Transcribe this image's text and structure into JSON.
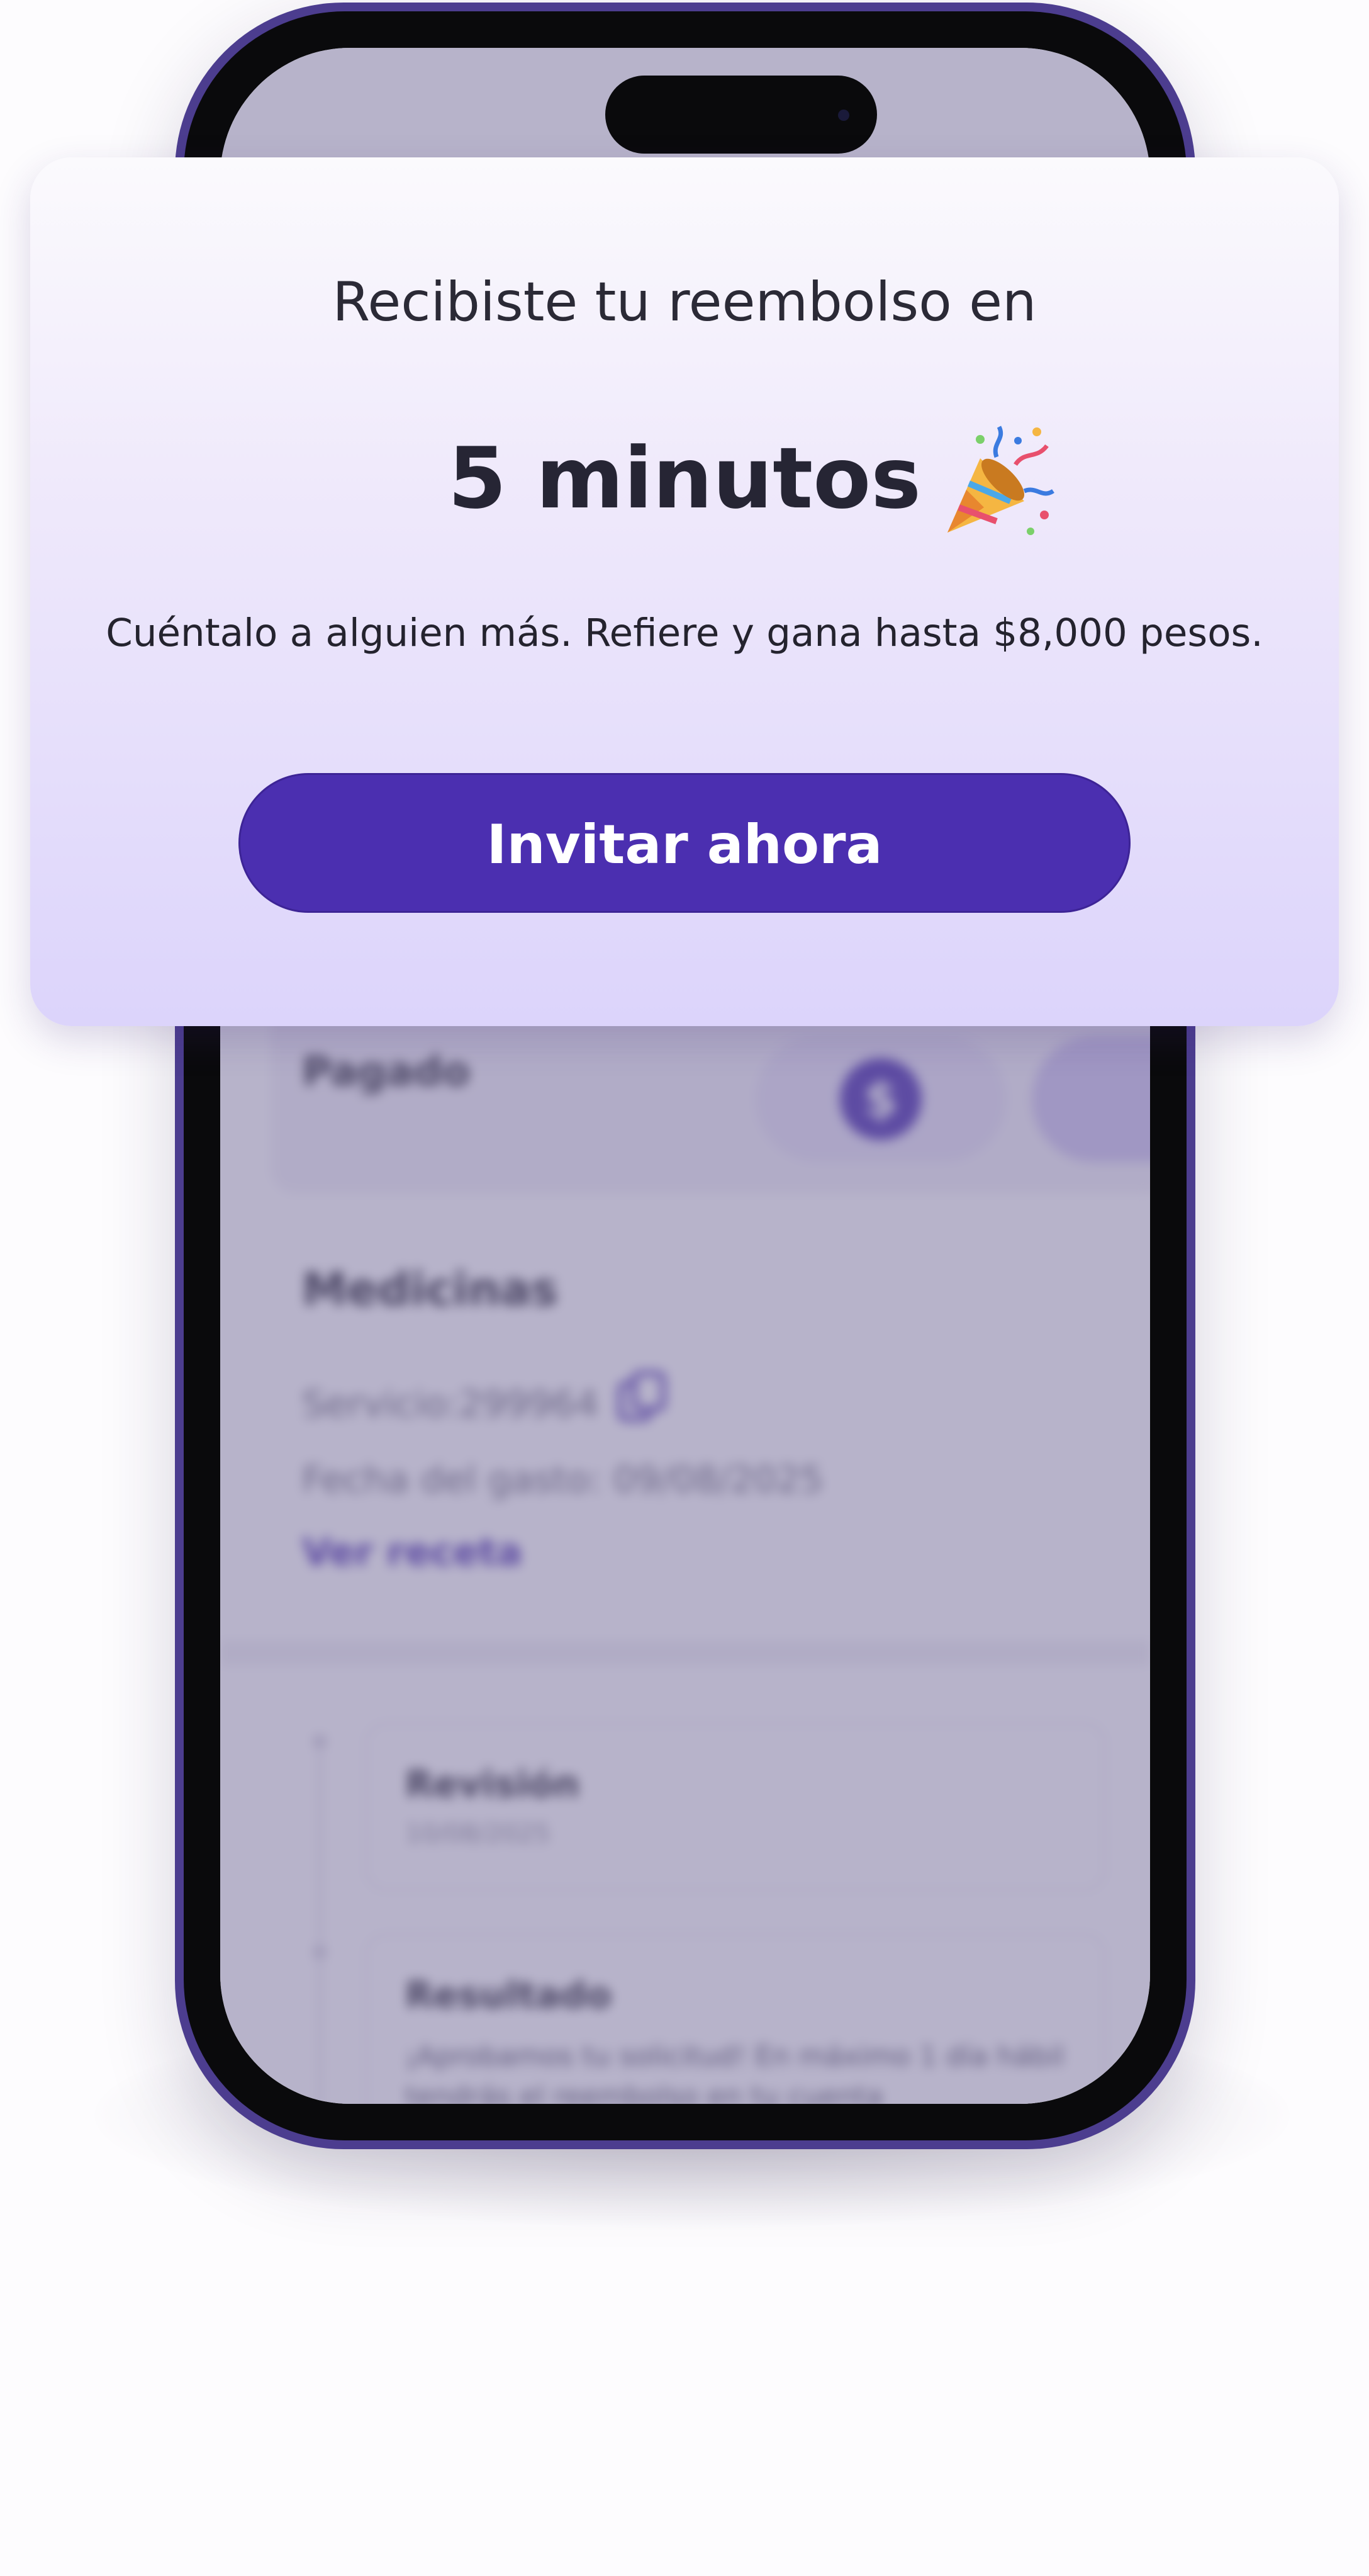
{
  "popup": {
    "title_line": "Recibiste tu reembolso en",
    "headline": "5 minutos",
    "icon": "party-popper-icon",
    "body": "Cuéntalo a alguien más. Refiere y gana hasta $8,000 pesos.",
    "cta_label": "Invitar ahora"
  },
  "background_app": {
    "status_label": "Pagado",
    "status_icon_label": "$",
    "section_title": "Medicinas",
    "service": "Servicio:299964",
    "expense_date": "Fecha del gasto: 09/08/2025",
    "link_label": "Ver receta",
    "timeline": [
      {
        "title": "Revisión",
        "date": "10/08/2025"
      },
      {
        "title": "Resultado",
        "body": "¡Aprobamos tu solicitud! En máximo 1 día hábil tendrás el reembolso en tu cuenta"
      }
    ]
  },
  "colors": {
    "brand_purple": "#4b2fb0",
    "phone_frame": "#4c3d8f",
    "popup_gradient_bottom": "#dcd4fb"
  }
}
